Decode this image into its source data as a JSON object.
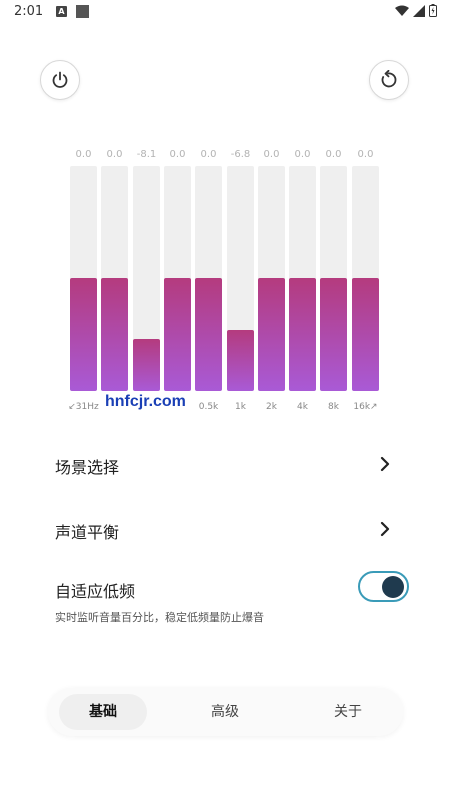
{
  "status": {
    "time": "2:01",
    "icon_a_label": "A"
  },
  "header": {
    "power_icon": "power-icon",
    "reset_icon": "reset-icon"
  },
  "equalizer": {
    "bands": [
      {
        "freq": "↙31Hz",
        "value": "0.0",
        "level": 0.5
      },
      {
        "freq": "",
        "value": "0.0",
        "level": 0.5
      },
      {
        "freq": "",
        "value": "-8.1",
        "level": 0.23
      },
      {
        "freq": "",
        "value": "0.0",
        "level": 0.5
      },
      {
        "freq": "0.5k",
        "value": "0.0",
        "level": 0.5
      },
      {
        "freq": "1k",
        "value": "-6.8",
        "level": 0.27
      },
      {
        "freq": "2k",
        "value": "0.0",
        "level": 0.5
      },
      {
        "freq": "4k",
        "value": "0.0",
        "level": 0.5
      },
      {
        "freq": "8k",
        "value": "0.0",
        "level": 0.5
      },
      {
        "freq": "16k↗",
        "value": "0.0",
        "level": 0.5
      }
    ],
    "colors": {
      "fill_top": "#b43b7e",
      "fill_bottom": "#a95ad6",
      "track": "#efefef"
    }
  },
  "watermark": "hnfcjr.com",
  "settings": {
    "scene_select": "场景选择",
    "channel_balance": "声道平衡",
    "adaptive_bass": {
      "title": "自适应低频",
      "subtitle": "实时监听音量百分比，稳定低频量防止爆音",
      "enabled": true
    }
  },
  "tabs": [
    {
      "label": "基础",
      "active": true
    },
    {
      "label": "高级",
      "active": false
    },
    {
      "label": "关于",
      "active": false
    }
  ],
  "accent_color": "#3a9bb8"
}
